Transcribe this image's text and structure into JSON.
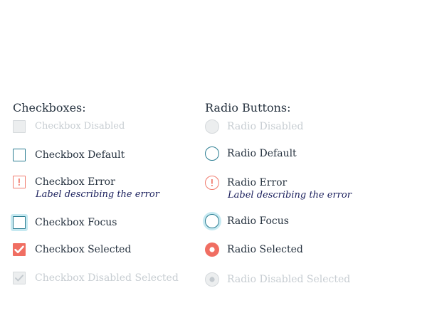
{
  "checkboxes": {
    "heading": "Checkboxes:",
    "items": [
      {
        "label": "Checkbox Disabled"
      },
      {
        "label": "Checkbox Default"
      },
      {
        "label": "Checkbox Error",
        "sublabel": "Label describing the error"
      },
      {
        "label": "Checkbox Focus"
      },
      {
        "label": "Checkbox Selected"
      },
      {
        "label": "Checkbox Disabled Selected"
      }
    ]
  },
  "radios": {
    "heading": "Radio Buttons:",
    "items": [
      {
        "label": "Radio Disabled"
      },
      {
        "label": "Radio Default"
      },
      {
        "label": "Radio Error",
        "sublabel": "Label describing the error"
      },
      {
        "label": "Radio Focus"
      },
      {
        "label": "Radio Selected"
      },
      {
        "label": "Radio Disabled Selected"
      }
    ]
  },
  "icons": {
    "error": "exclamation-icon",
    "selected": "checkmark-icon",
    "radio_selected": "radio-dot-icon"
  },
  "colors": {
    "accent": "#2b7d92",
    "error": "#f07b6e",
    "selected": "#f06e62",
    "focus_ring": "#c6e9f1",
    "disabled": "#d5d9dc",
    "error_text": "#1a1f5c"
  }
}
